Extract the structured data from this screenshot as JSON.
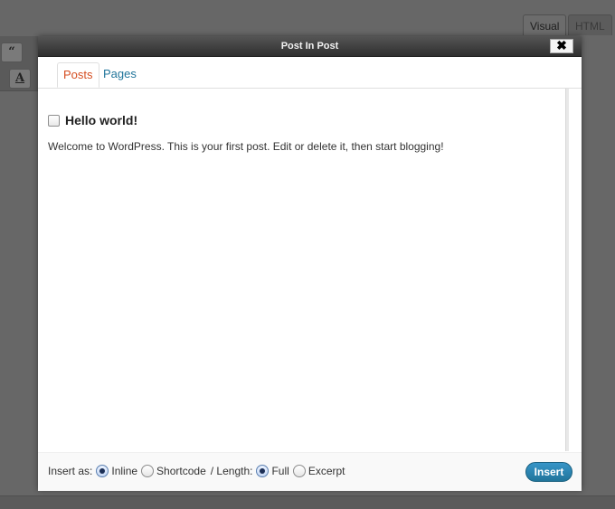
{
  "background": {
    "tabs": [
      "Visual",
      "HTML"
    ],
    "toolbar_glyphs": [
      "“",
      "A"
    ]
  },
  "modal": {
    "title": "Post In Post",
    "close_glyph": "✖",
    "tabs": [
      {
        "label": "Posts",
        "active": true
      },
      {
        "label": "Pages",
        "active": false
      }
    ],
    "post": {
      "title": "Hello world!",
      "checked": false,
      "excerpt": "Welcome to WordPress. This is your first post. Edit or delete it, then start blogging!"
    },
    "footer": {
      "insert_as_label": "Insert as:",
      "inline_label": "Inline",
      "shortcode_label": "Shortcode",
      "length_label": "/ Length:",
      "full_label": "Full",
      "excerpt_label": "Excerpt",
      "insert_as_selected": "Inline",
      "length_selected": "Full",
      "insert_button": "Insert"
    }
  },
  "colors": {
    "active_tab": "#d54e21",
    "link": "#21759b",
    "insert_button": "#21759b"
  }
}
